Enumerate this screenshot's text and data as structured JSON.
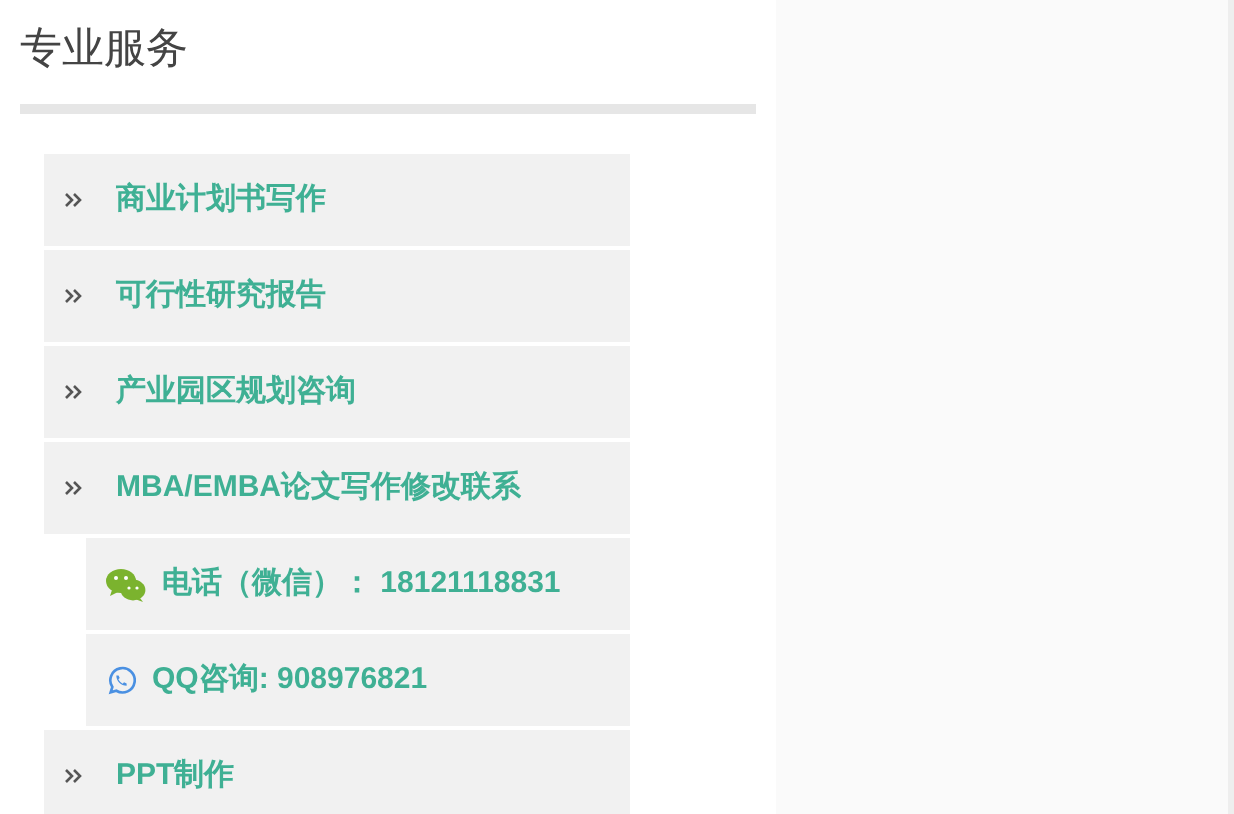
{
  "section": {
    "title": "专业服务"
  },
  "menu": [
    {
      "label": "商业计划书写作"
    },
    {
      "label": "可行性研究报告"
    },
    {
      "label": "产业园区规划咨询"
    },
    {
      "label": "MBA/EMBA论文写作修改联系",
      "children": [
        {
          "kind": "chat",
          "label": "电话（微信）： 18121118831"
        },
        {
          "kind": "phone",
          "label": "QQ咨询: 908976821"
        }
      ]
    },
    {
      "label": "PPT制作"
    }
  ]
}
